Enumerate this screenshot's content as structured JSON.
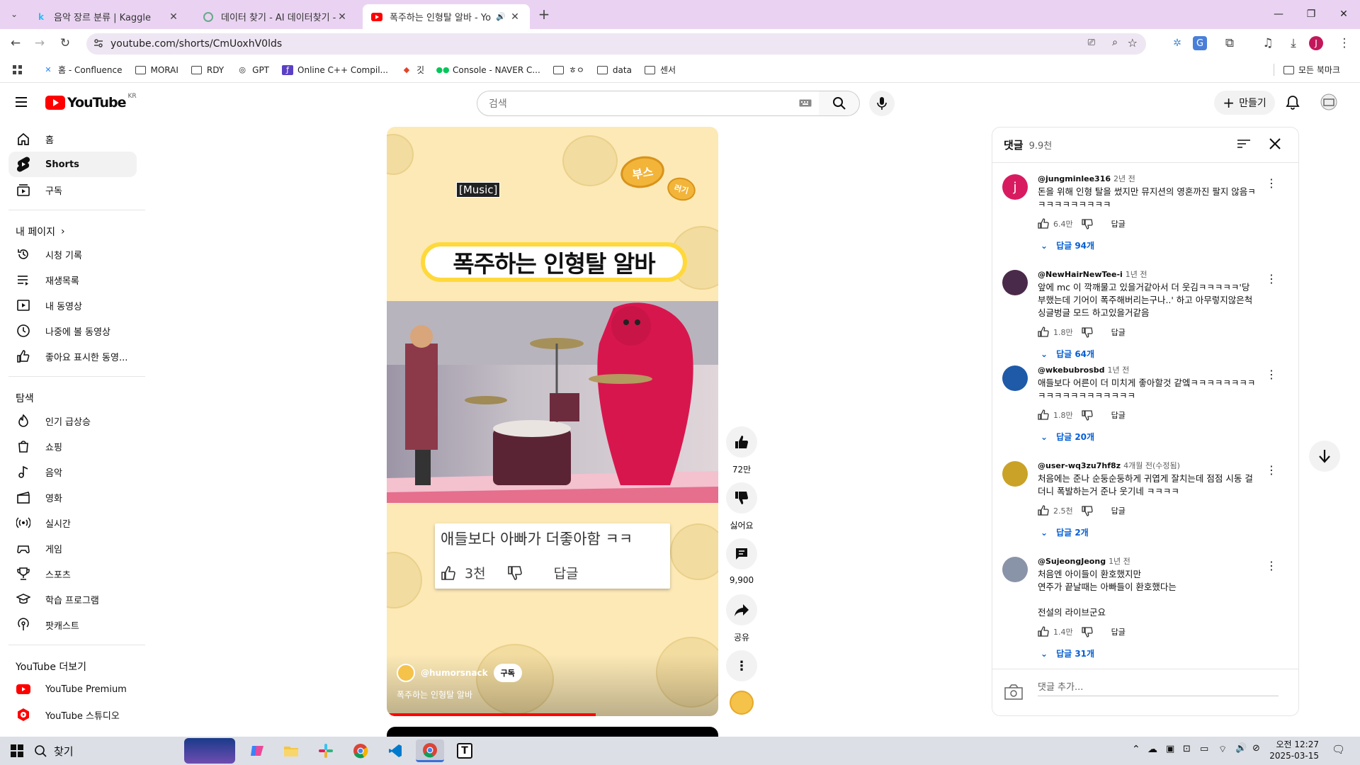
{
  "browser": {
    "tabs": [
      {
        "title": "음악 장르 분류 | Kaggle",
        "favicon": "kaggle-k"
      },
      {
        "title": "데이터 찾기 - AI 데이터찾기 -",
        "favicon": "aihub"
      },
      {
        "title": "폭주하는 인형탈 알바 - Yo",
        "favicon": "youtube",
        "active": true
      }
    ],
    "new_tab_label": "+",
    "url": "youtube.com/shorts/CmUoxhV0lds",
    "bookmarks": [
      {
        "label": "",
        "icon": "apps-grid-icon"
      },
      {
        "label": "홈 - Confluence",
        "icon": "confluence-icon"
      },
      {
        "label": "MORAI",
        "icon": "folder-icon"
      },
      {
        "label": "RDY",
        "icon": "folder-icon"
      },
      {
        "label": "GPT",
        "icon": "gpt-icon"
      },
      {
        "label": "Online C++ Compil...",
        "icon": "code-icon"
      },
      {
        "label": "깃",
        "icon": "gitlab-icon"
      },
      {
        "label": "Console - NAVER C...",
        "icon": "naver-icon"
      },
      {
        "label": "ㅎㅇ",
        "icon": "folder-icon"
      },
      {
        "label": "data",
        "icon": "folder-icon"
      },
      {
        "label": "센서",
        "icon": "folder-icon"
      }
    ],
    "all_bookmarks": "모든 북마크"
  },
  "youtube": {
    "logo": "YouTube",
    "region": "KR",
    "search_placeholder": "검색",
    "create_label": "만들기",
    "sidebar": {
      "main": [
        {
          "label": "홈",
          "icon": "home-icon"
        },
        {
          "label": "Shorts",
          "icon": "shorts-icon",
          "active": true
        },
        {
          "label": "구독",
          "icon": "subscriptions-icon"
        }
      ],
      "you_header": "내 페이지",
      "you": [
        {
          "label": "시청 기록",
          "icon": "history-icon"
        },
        {
          "label": "재생목록",
          "icon": "playlist-icon"
        },
        {
          "label": "내 동영상",
          "icon": "my-videos-icon"
        },
        {
          "label": "나중에 볼 동영상",
          "icon": "watch-later-icon"
        },
        {
          "label": "좋아요 표시한 동영...",
          "icon": "liked-icon"
        }
      ],
      "explore_header": "탐색",
      "explore": [
        {
          "label": "인기 급상승",
          "icon": "trending-icon"
        },
        {
          "label": "쇼핑",
          "icon": "shopping-icon"
        },
        {
          "label": "음악",
          "icon": "music-icon"
        },
        {
          "label": "영화",
          "icon": "movie-icon"
        },
        {
          "label": "실시간",
          "icon": "live-icon"
        },
        {
          "label": "게임",
          "icon": "gaming-icon"
        },
        {
          "label": "스포츠",
          "icon": "sports-icon"
        },
        {
          "label": "학습 프로그램",
          "icon": "learning-icon"
        },
        {
          "label": "팟캐스트",
          "icon": "podcast-icon"
        }
      ],
      "more_header": "YouTube 더보기",
      "more": [
        {
          "label": "YouTube Premium",
          "icon": "youtube-premium-icon"
        },
        {
          "label": "YouTube 스튜디오",
          "icon": "youtube-studio-icon"
        }
      ]
    },
    "video": {
      "music_caption": "[Music]",
      "sticker_text_1": "부스",
      "sticker_text_2": "러기",
      "banner_title": "폭주하는 인형탈 알바",
      "overlay_comment": "애들보다 아빠가 더좋아함 ㅋㅋ",
      "overlay_likes": "3천",
      "overlay_reply": "답글",
      "channel": "@humorsnack",
      "subscribe": "구독",
      "title": "폭주하는 인형탈 알바",
      "progress": 0.63
    },
    "actions": {
      "likes": "72만",
      "dislike": "싫어요",
      "comments": "9,900",
      "share": "공유"
    },
    "comments": {
      "title": "댓글",
      "count": "9.9천",
      "add_placeholder": "댓글 추가...",
      "reply_label": "답글",
      "items": [
        {
          "author": "@jungminlee316",
          "time": "2년 전",
          "text": "돈을 위해 인형 탈을 썼지만 뮤지션의 영혼까진 팔지 않음ㅋㅋㅋㅋㅋㅋㅋㅋㅋㅋ",
          "likes": "6.4만",
          "replies": "답글 94개",
          "avatar_color": "#d81b60",
          "avatar_letter": "j"
        },
        {
          "author": "@NewHairNewTee-i",
          "time": "1년 전",
          "text": "앞에 mc 이 깍깨물고 있을거같아서 더 웃김ㅋㅋㅋㅋㅋ'당부했는데 기어이 폭주해버리는구나..' 하고 아무렇지않은척 싱글벙글 모드 하고있을거같음",
          "likes": "1.8만",
          "replies": "답글 64개",
          "avatar_color": "#4a2a4a",
          "avatar_letter": ""
        },
        {
          "author": "@wkebubrosbd",
          "time": "1년 전",
          "text": "애들보다 어른이 더 미치게 좋아할것 같엨ㅋㅋㅋㅋㅋㅋㅋㅋㅋㅋㅋㅋㅋㅋㅋㅋㅋㅋㅋㅋ",
          "likes": "1.8만",
          "replies": "답글 20개",
          "avatar_color": "#1e5aa8",
          "avatar_letter": ""
        },
        {
          "author": "@user-wq3zu7hf8z",
          "time": "4개월 전(수정됨)",
          "text": "처음에는 준나 순둥순둥하게 귀엽게 잘치는데 점점 시동 걸더니 폭발하는거 준나 웃기네 ㅋㅋㅋㅋ",
          "likes": "2.5천",
          "replies": "답글 2개",
          "avatar_color": "#c9a227",
          "avatar_letter": ""
        },
        {
          "author": "@SujeongJeong",
          "time": "1년 전",
          "text": "처음엔 아이들이 환호했지만\n연주가 끝날때는 아빠들이 환호했다는\n\n전설의 라이브군요",
          "likes": "1.4만",
          "replies": "답글 31개",
          "avatar_color": "#8a94a8",
          "avatar_letter": ""
        }
      ]
    }
  },
  "taskbar": {
    "search_label": "찾기",
    "time": "오전 12:27",
    "date": "2025-03-15"
  }
}
